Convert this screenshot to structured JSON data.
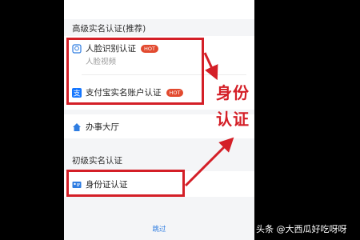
{
  "sections": {
    "advanced_title": "高级实名认证(推荐)",
    "basic_title": "初级实名认证"
  },
  "items": {
    "face": {
      "label": "人脸识别认证",
      "badge": "HOT",
      "sub": "人脸视频"
    },
    "alipay": {
      "label": "支付宝实名账户认证",
      "badge": "HOT"
    },
    "hall": {
      "label": "办事大厅"
    },
    "idcard": {
      "label": "身份证认证"
    }
  },
  "annotation": {
    "line1": "身份",
    "line2": "认证"
  },
  "skip_label": "跳过",
  "watermark": "头条 @大西瓜好吃呀呀",
  "colors": {
    "accent_red": "#d41f27",
    "link_blue": "#2f7de1",
    "hot_badge": "#e24a2f"
  }
}
